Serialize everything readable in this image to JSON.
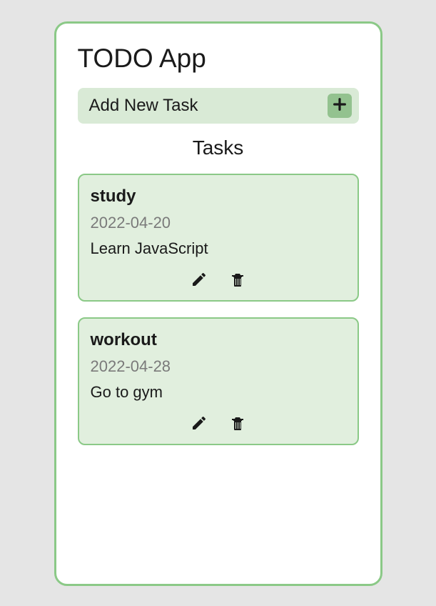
{
  "app": {
    "title": "TODO App"
  },
  "addTask": {
    "label": "Add New Task"
  },
  "tasksHeading": "Tasks",
  "tasks": [
    {
      "title": "study",
      "date": "2022-04-20",
      "description": "Learn JavaScript"
    },
    {
      "title": "workout",
      "date": "2022-04-28",
      "description": "Go to gym"
    }
  ]
}
